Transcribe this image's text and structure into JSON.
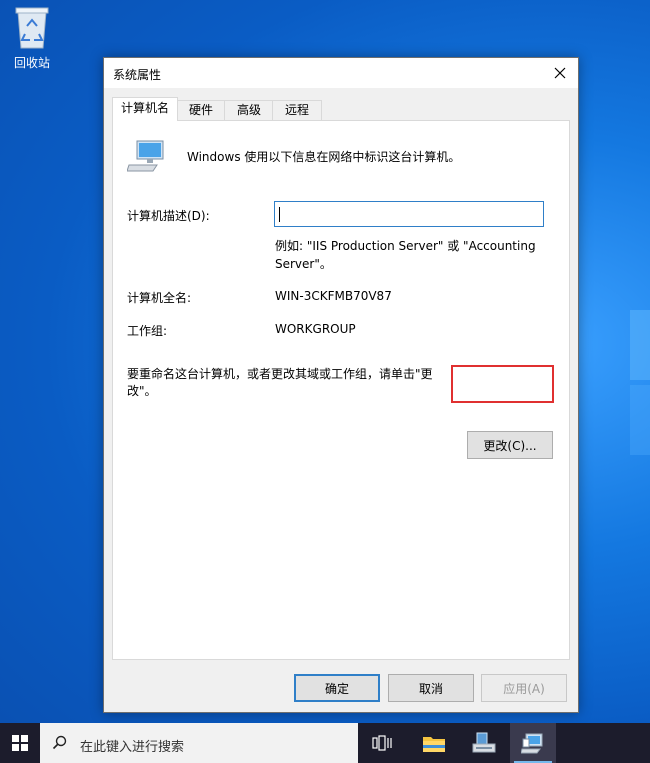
{
  "desktop": {
    "recycle_bin_label": "回收站"
  },
  "dialog": {
    "title": "系统属性",
    "tabs": [
      {
        "label": "计算机名",
        "active": true
      },
      {
        "label": "硬件",
        "active": false
      },
      {
        "label": "高级",
        "active": false
      },
      {
        "label": "远程",
        "active": false
      }
    ],
    "intro_text": "Windows 使用以下信息在网络中标识这台计算机。",
    "description_label": "计算机描述(D):",
    "description_value": "",
    "example_text": "例如: \"IIS Production Server\" 或 \"Accounting Server\"。",
    "full_name_label": "计算机全名:",
    "full_name_value": "WIN-3CKFMB70V87",
    "workgroup_label": "工作组:",
    "workgroup_value": "WORKGROUP",
    "rename_text": "要重命名这台计算机，或者更改其域或工作组，请单击\"更改\"。",
    "change_button": "更改(C)...",
    "ok_button": "确定",
    "cancel_button": "取消",
    "apply_button": "应用(A)"
  },
  "taskbar": {
    "search_placeholder": "在此键入进行搜索"
  },
  "colors": {
    "accent": "#2f7fc8",
    "highlight": "#e03030",
    "taskbar": "#1c1c2c"
  }
}
